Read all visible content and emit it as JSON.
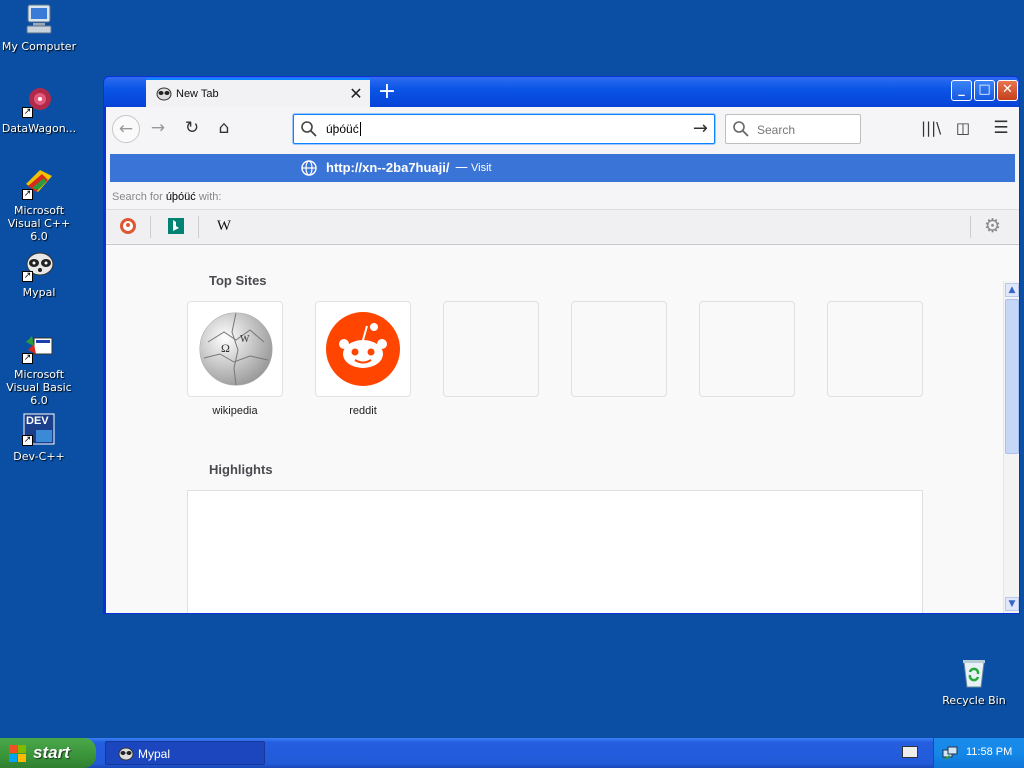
{
  "desktop": {
    "icons": [
      {
        "label": "My Computer",
        "shortcut": false
      },
      {
        "label": "DataWagon...",
        "shortcut": true
      },
      {
        "label": "Microsoft Visual C++ 6.0",
        "shortcut": true
      },
      {
        "label": "Mypal",
        "shortcut": true
      },
      {
        "label": "Microsoft Visual Basic 6.0",
        "shortcut": true
      },
      {
        "label": "Dev-C++",
        "shortcut": true,
        "badge": "DEV"
      }
    ],
    "recycle_bin": {
      "label": "Recycle Bin"
    }
  },
  "browser": {
    "tab": {
      "title": "New Tab",
      "close": "✕"
    },
    "new_tab": "+",
    "window_controls": {
      "minimize": "_",
      "maximize": "□",
      "close": "✕"
    },
    "toolbar": {
      "back": "←",
      "forward": "→",
      "reload": "↻",
      "home": "⌂",
      "url_value": "úþóüć",
      "go": "→",
      "search_placeholder": "Search",
      "library": "|||\\",
      "sidebar": "◫",
      "menu": "☰"
    },
    "dropdown": {
      "suggestion_url": "http://xn--2ba7huaji/",
      "suggestion_dash": "—",
      "suggestion_action": "Visit",
      "search_for_prefix": "Search for",
      "search_for_term": "úþóüć",
      "search_for_suffix": "with:",
      "engines": [
        {
          "name": "duckduckgo-icon",
          "color": "#de5833"
        },
        {
          "name": "bing-icon",
          "color": "#008373"
        },
        {
          "name": "wikipedia-icon",
          "glyph": "W"
        }
      ],
      "settings": "⚙"
    },
    "newtab_page": {
      "top_sites_title": "Top Sites",
      "top_sites": [
        {
          "label": "wikipedia",
          "icon": "wikipedia-globe-icon"
        },
        {
          "label": "reddit",
          "icon": "reddit-icon",
          "color": "#ff4500"
        },
        {
          "label": ""
        },
        {
          "label": ""
        },
        {
          "label": ""
        },
        {
          "label": ""
        }
      ],
      "highlights_title": "Highlights"
    }
  },
  "taskbar": {
    "start_label": "start",
    "task_label": "Mypal",
    "clock": "11:58 PM"
  },
  "colors": {
    "desktop_bg": "#0a4fa3",
    "accent_blue": "#0a84ff",
    "suggestion_bg": "#3a74d6",
    "start_green": "#3a943a"
  }
}
